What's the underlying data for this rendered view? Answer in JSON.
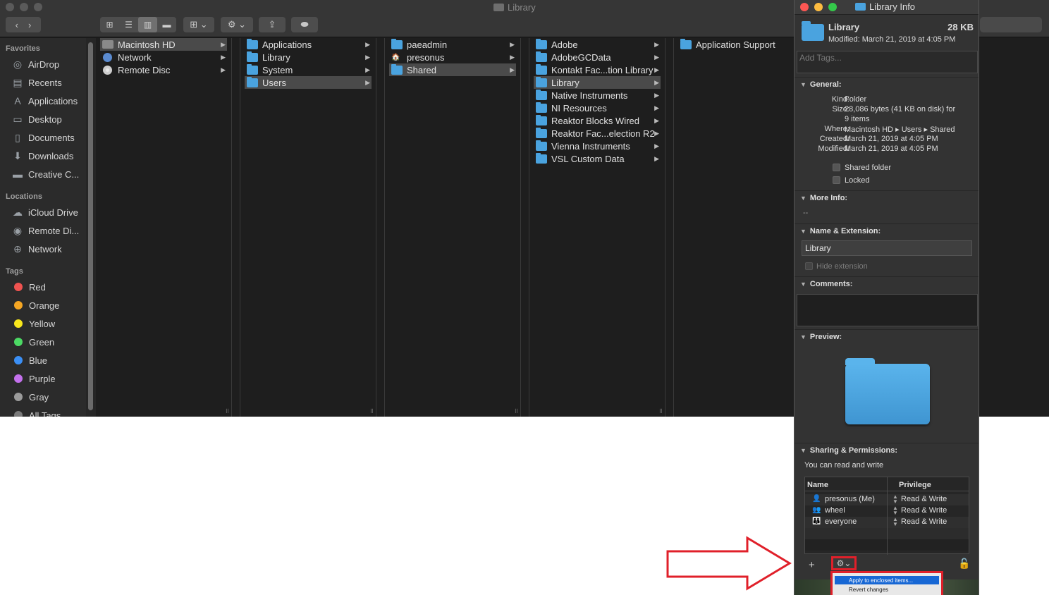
{
  "finder": {
    "window_title": "Library",
    "sidebar": {
      "favorites_header": "Favorites",
      "favorites": [
        {
          "label": "AirDrop",
          "icon": "airdrop-icon",
          "glyph": "◎"
        },
        {
          "label": "Recents",
          "icon": "recents-icon",
          "glyph": "▤"
        },
        {
          "label": "Applications",
          "icon": "applications-icon",
          "glyph": "A"
        },
        {
          "label": "Desktop",
          "icon": "desktop-icon",
          "glyph": "▭"
        },
        {
          "label": "Documents",
          "icon": "documents-icon",
          "glyph": "▯"
        },
        {
          "label": "Downloads",
          "icon": "downloads-icon",
          "glyph": "⬇"
        },
        {
          "label": "Creative C...",
          "icon": "folder-icon",
          "glyph": "▬"
        }
      ],
      "locations_header": "Locations",
      "locations": [
        {
          "label": "iCloud Drive",
          "icon": "cloud-icon",
          "glyph": "☁"
        },
        {
          "label": "Remote Di...",
          "icon": "disc-icon",
          "glyph": "◉"
        },
        {
          "label": "Network",
          "icon": "network-icon",
          "glyph": "⊕"
        }
      ],
      "tags_header": "Tags",
      "tags": [
        {
          "label": "Red",
          "color": "#ef5350"
        },
        {
          "label": "Orange",
          "color": "#f5a623"
        },
        {
          "label": "Yellow",
          "color": "#f8e71c"
        },
        {
          "label": "Green",
          "color": "#4cd964"
        },
        {
          "label": "Blue",
          "color": "#3b8ff5"
        },
        {
          "label": "Purple",
          "color": "#c471ed"
        },
        {
          "label": "Gray",
          "color": "#9b9b9b"
        },
        {
          "label": "All Tags...",
          "color": "#7a7a7a"
        }
      ]
    },
    "columns": [
      [
        {
          "label": "Macintosh HD",
          "icon": "disk",
          "selected": true,
          "arrow": true
        },
        {
          "label": "Network",
          "icon": "globe",
          "selected": false,
          "arrow": true
        },
        {
          "label": "Remote Disc",
          "icon": "disc",
          "selected": false,
          "arrow": true
        }
      ],
      [
        {
          "label": "Applications",
          "icon": "folder",
          "selected": false,
          "arrow": true
        },
        {
          "label": "Library",
          "icon": "folder",
          "selected": false,
          "arrow": true
        },
        {
          "label": "System",
          "icon": "folder",
          "selected": false,
          "arrow": true
        },
        {
          "label": "Users",
          "icon": "folder",
          "selected": true,
          "arrow": true
        }
      ],
      [
        {
          "label": "paeadmin",
          "icon": "folder",
          "selected": false,
          "arrow": true
        },
        {
          "label": "presonus",
          "icon": "home",
          "selected": false,
          "arrow": true
        },
        {
          "label": "Shared",
          "icon": "folder",
          "selected": true,
          "arrow": true
        }
      ],
      [
        {
          "label": "Adobe",
          "icon": "folder",
          "selected": false,
          "arrow": true
        },
        {
          "label": "AdobeGCData",
          "icon": "folder",
          "selected": false,
          "arrow": true
        },
        {
          "label": "Kontakt Fac...tion Library",
          "icon": "folder",
          "selected": false,
          "arrow": true
        },
        {
          "label": "Library",
          "icon": "folder",
          "selected": true,
          "arrow": true
        },
        {
          "label": "Native Instruments",
          "icon": "folder",
          "selected": false,
          "arrow": true
        },
        {
          "label": "NI Resources",
          "icon": "folder",
          "selected": false,
          "arrow": true
        },
        {
          "label": "Reaktor Blocks Wired",
          "icon": "folder",
          "selected": false,
          "arrow": true
        },
        {
          "label": "Reaktor Fac...election R2",
          "icon": "folder",
          "selected": false,
          "arrow": true
        },
        {
          "label": "Vienna Instruments",
          "icon": "folder",
          "selected": false,
          "arrow": true
        },
        {
          "label": "VSL Custom Data",
          "icon": "folder",
          "selected": false,
          "arrow": true
        }
      ],
      [
        {
          "label": "Application Support",
          "icon": "folder",
          "selected": false,
          "arrow": false
        }
      ]
    ]
  },
  "info": {
    "window_title": "Library Info",
    "name": "Library",
    "size": "28 KB",
    "modified_line": "Modified: March 21, 2019 at 4:05 PM",
    "tags_placeholder": "Add Tags...",
    "general": {
      "header": "General:",
      "kind_label": "Kind:",
      "kind": "Folder",
      "size_label": "Size:",
      "size_line1": "28,086 bytes (41 KB on disk) for",
      "size_line2": "9 items",
      "where_label": "Where:",
      "where": "Macintosh HD ▸ Users ▸ Shared",
      "created_label": "Created:",
      "created": "March 21, 2019 at 4:05 PM",
      "modified_label": "Modified:",
      "modified": "March 21, 2019 at 4:05 PM",
      "shared_folder": "Shared folder",
      "locked": "Locked"
    },
    "more_info": {
      "header": "More Info:",
      "value": "--"
    },
    "name_ext": {
      "header": "Name & Extension:",
      "value": "Library",
      "hide_extension": "Hide extension"
    },
    "comments": {
      "header": "Comments:"
    },
    "preview": {
      "header": "Preview:"
    },
    "sharing": {
      "header": "Sharing & Permissions:",
      "summary": "You can read and write",
      "col_name": "Name",
      "col_privilege": "Privilege",
      "rows": [
        {
          "name": "presonus (Me)",
          "privilege": "Read & Write",
          "icon": "user-icon"
        },
        {
          "name": "wheel",
          "privilege": "Read & Write",
          "icon": "group-icon"
        },
        {
          "name": "everyone",
          "privilege": "Read & Write",
          "icon": "everyone-icon"
        }
      ]
    },
    "menu": {
      "apply": "Apply to enclosed items...",
      "revert": "Revert changes"
    }
  },
  "annotation_color": "#e0202a"
}
